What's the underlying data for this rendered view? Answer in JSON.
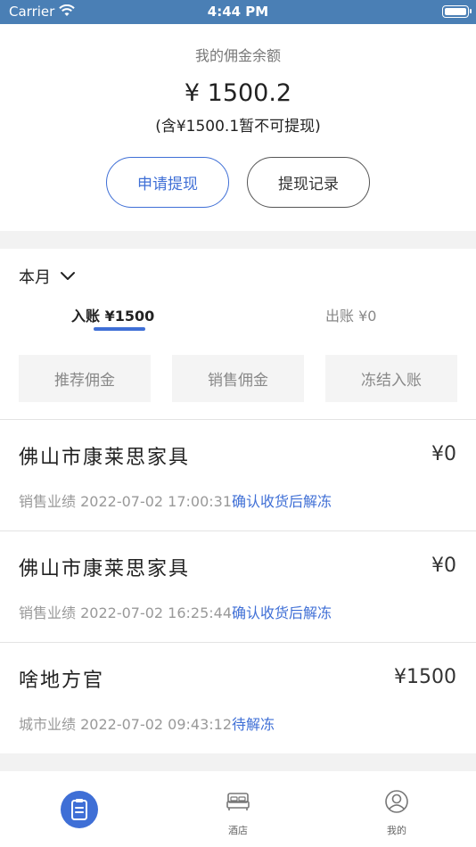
{
  "status_bar": {
    "carrier": "Carrier",
    "time": "4:44 PM"
  },
  "balance": {
    "label": "我的佣金余额",
    "amount": "¥ 1500.2",
    "note": "(含¥1500.1暂不可提现)",
    "apply_button": "申请提现",
    "record_button": "提现记录"
  },
  "filter": {
    "month": "本月"
  },
  "tabs": {
    "income": "入账 ¥1500",
    "expense": "出账 ¥0"
  },
  "categories": [
    "推荐佣金",
    "销售佣金",
    "冻结入账"
  ],
  "records": [
    {
      "name": "佛山市康莱思家具",
      "amount": "¥0",
      "type": "销售业绩",
      "datetime": "2022-07-02 17:00:31",
      "status": "确认收货后解冻"
    },
    {
      "name": "佛山市康莱思家具",
      "amount": "¥0",
      "type": "销售业绩",
      "datetime": "2022-07-02 16:25:44",
      "status": "确认收货后解冻"
    },
    {
      "name": "啥地方官",
      "amount": "¥1500",
      "type": "城市业绩",
      "datetime": "2022-07-02 09:43:12",
      "status": "待解冻"
    }
  ],
  "tabbar": {
    "items": [
      {
        "label": "",
        "icon": "clipboard-icon"
      },
      {
        "label": "酒店",
        "icon": "bed-icon"
      },
      {
        "label": "我的",
        "icon": "user-icon"
      }
    ]
  },
  "colors": {
    "accent": "#3f6fd6",
    "status_bar": "#4a7fb5"
  }
}
